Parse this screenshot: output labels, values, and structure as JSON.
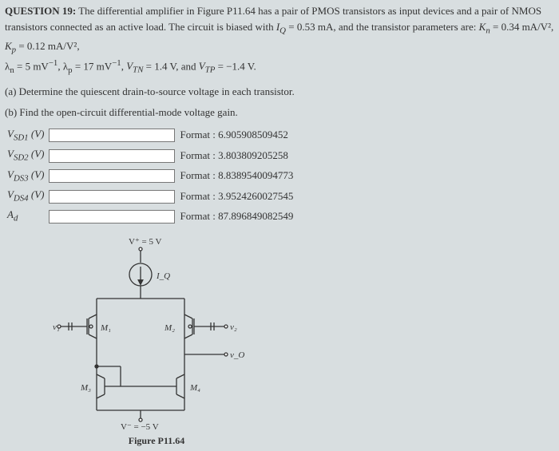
{
  "question": {
    "heading": "QUESTION 19:",
    "body": "The differential amplifier in Figure P11.64 has a pair of PMOS transistors as input devices and a pair of NMOS transistors connected as an active load. The circuit is biased with ",
    "IQ": "I_Q = 0.53 mA",
    "params": ", and the transistor parameters are: K_n = 0.34 mA/V², K_p = 0.12 mA/V², λ_n = 5 mV⁻¹, λ_p = 17 mV⁻¹, V_TN = 1.4 V, and V_TP = −1.4 V.",
    "partA": "(a) Determine the quiescent drain-to-source voltage in each transistor.",
    "partB": "(b) Find the open-circuit differential-mode voltage gain."
  },
  "answers": [
    {
      "label": "V_{SD1} (V)",
      "format": "6.905908509452"
    },
    {
      "label": "V_{SD2} (V)",
      "format": "3.803809205258"
    },
    {
      "label": "V_{DS3} (V)",
      "format": "8.8389540094773"
    },
    {
      "label": "V_{DS4} (V)",
      "format": "3.9524260027545"
    },
    {
      "label": "A_d",
      "format": "87.896849082549"
    }
  ],
  "rowlabels": [
    "V",
    "V",
    "V",
    "V",
    "A"
  ],
  "rowsubs": [
    "SD1",
    "SD2",
    "DS3",
    "DS4",
    "d"
  ],
  "rowunits": [
    " (V)",
    " (V)",
    " (V)",
    " (V)",
    ""
  ],
  "figure": {
    "vplus": "V⁺ = 5 V",
    "vminus": "V⁻ = −5 V",
    "IQ": "I_Q",
    "M1": "M₁",
    "M2": "M₂",
    "M3": "M₃",
    "M4": "M₄",
    "v1": "v₁",
    "v2": "v₂",
    "vo": "v_O",
    "caption": "Figure P11.64"
  }
}
